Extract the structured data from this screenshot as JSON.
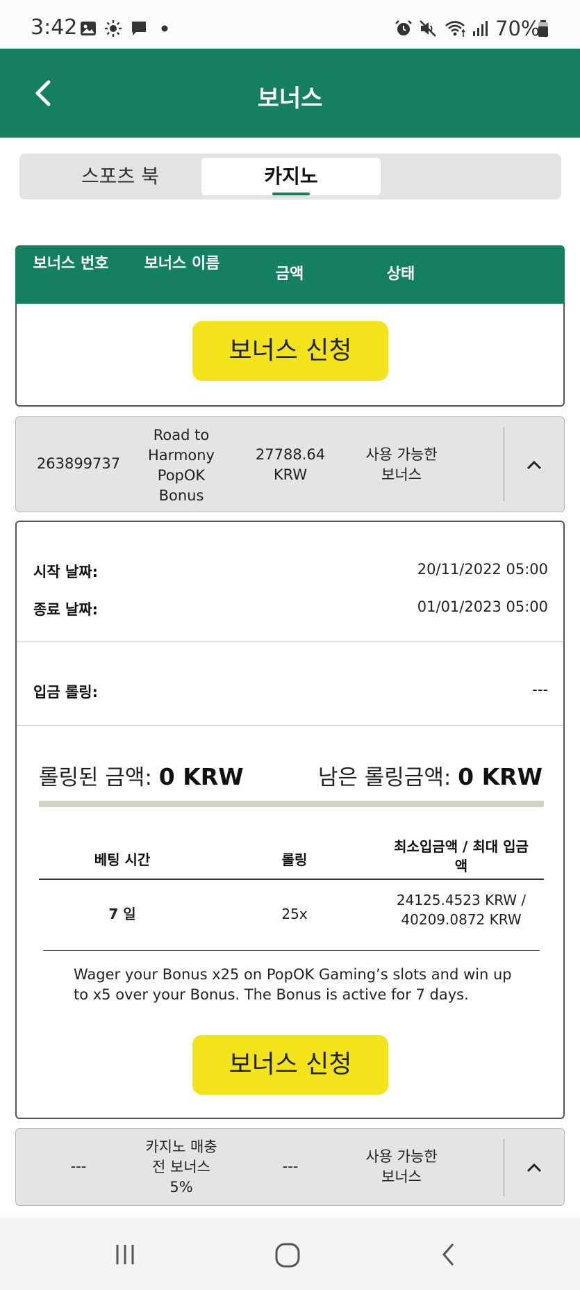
{
  "status_bar": {
    "time": "3:42",
    "battery": "70%",
    "left_icons": [
      "gallery-icon",
      "brightness-icon",
      "message-icon",
      "dot-icon"
    ],
    "right_icons": [
      "alarm-icon",
      "mute-icon",
      "wifi-icon",
      "signal-icon",
      "battery-icon"
    ]
  },
  "header": {
    "title": "보너스"
  },
  "tabs": [
    {
      "label": "스포츠 북",
      "active": false
    },
    {
      "label": "카지노",
      "active": true
    }
  ],
  "table": {
    "columns": [
      "보너스 번호",
      "보너스 이름",
      "금액",
      "상태"
    ]
  },
  "apply_button_label": "보너스 신청",
  "rows": [
    {
      "id": "263899737",
      "name": "Road to Harmony PopOK Bonus",
      "amount": "27788.64 KRW",
      "status": "사용 가능한 보너스"
    },
    {
      "id": "---",
      "name": "카지노 매충전 보너스 5%",
      "amount": "---",
      "status": "사용 가능한 보너스"
    }
  ],
  "details": {
    "start_label": "시작 날짜:",
    "start_value": "20/11/2022 05:00",
    "end_label": "종료 날짜:",
    "end_value": "01/01/2023 05:00",
    "deposit_rolling_label": "입금 롤링:",
    "deposit_rolling_value": "---",
    "rolled_label": "롤링된 금액:",
    "rolled_value": "0 KRW",
    "remaining_label": "남은 롤링금액:",
    "remaining_value": "0 KRW",
    "progress_fraction": 0,
    "sub_table": {
      "headers": [
        "베팅 시간",
        "롤링",
        "최소입금액 / 최대 입금액"
      ],
      "row": [
        "7 일",
        "25x",
        "24125.4523 KRW / 40209.0872 KRW"
      ]
    },
    "description": "Wager your Bonus x25 on PopOK Gaming’s slots and win up to x5 over your Bonus. The Bonus is active for 7 days."
  },
  "nav_bar": [
    "recents-icon",
    "home-icon",
    "back-icon"
  ]
}
